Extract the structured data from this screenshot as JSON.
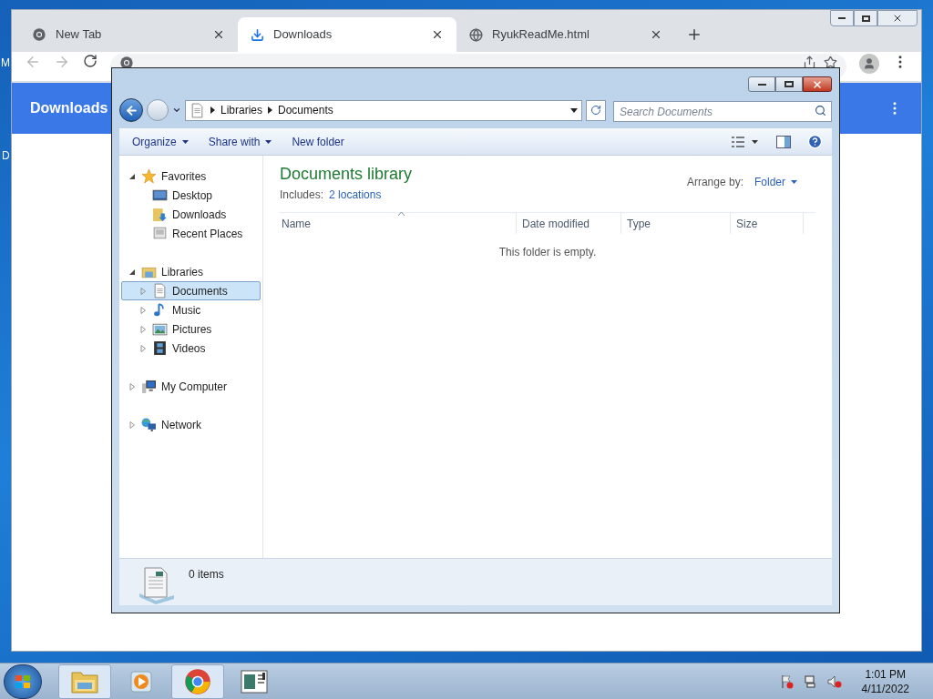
{
  "desktop": {
    "labels": [
      "M",
      "D"
    ]
  },
  "chrome": {
    "tabs": [
      {
        "title": "New Tab",
        "kind": "chrome",
        "selected": false
      },
      {
        "title": "Downloads",
        "kind": "download",
        "selected": true
      },
      {
        "title": "RyukReadMe.html",
        "kind": "globe",
        "selected": false
      }
    ],
    "header": {
      "title": "Downloads"
    }
  },
  "explorer": {
    "breadcrumb": [
      "Libraries",
      "Documents"
    ],
    "search": {
      "placeholder": "Search Documents"
    },
    "toolbar": [
      {
        "label": "Organize",
        "menu": true
      },
      {
        "label": "Share with",
        "menu": true
      },
      {
        "label": "New folder",
        "menu": false
      }
    ],
    "tree": [
      {
        "label": "Favorites",
        "kind": "favorites",
        "expanded": true,
        "selected": false,
        "children": [
          {
            "label": "Desktop",
            "kind": "desktop",
            "selected": false
          },
          {
            "label": "Downloads",
            "kind": "downloads",
            "selected": false
          },
          {
            "label": "Recent Places",
            "kind": "recent",
            "selected": false
          }
        ]
      },
      {
        "label": "Libraries",
        "kind": "libraries",
        "expanded": true,
        "selected": false,
        "children": [
          {
            "label": "Documents",
            "kind": "documents",
            "expanded": false,
            "selected": true
          },
          {
            "label": "Music",
            "kind": "music",
            "expanded": false,
            "selected": false
          },
          {
            "label": "Pictures",
            "kind": "pictures",
            "expanded": false,
            "selected": false
          },
          {
            "label": "Videos",
            "kind": "videos",
            "expanded": false,
            "selected": false
          }
        ]
      },
      {
        "label": "My Computer",
        "kind": "computer",
        "expanded": false,
        "selected": false
      },
      {
        "label": "Network",
        "kind": "network",
        "expanded": false,
        "selected": false
      }
    ],
    "library": {
      "title": "Documents library",
      "includes_label": "Includes:",
      "includes_link": "2 locations",
      "arrange_label": "Arrange by:",
      "arrange_value": "Folder"
    },
    "columns": [
      {
        "label": "Name",
        "sorted": true
      },
      {
        "label": "Date modified",
        "sorted": false
      },
      {
        "label": "Type",
        "sorted": false
      },
      {
        "label": "Size",
        "sorted": false
      }
    ],
    "empty_message": "This folder is empty.",
    "status": "0 items"
  },
  "taskbar": {
    "apps": [
      {
        "kind": "explorer",
        "active": true
      },
      {
        "kind": "media",
        "active": false
      },
      {
        "kind": "chrome",
        "active": true
      },
      {
        "kind": "window",
        "active": false
      }
    ],
    "time": "1:01 PM",
    "date": "4/11/2022"
  }
}
